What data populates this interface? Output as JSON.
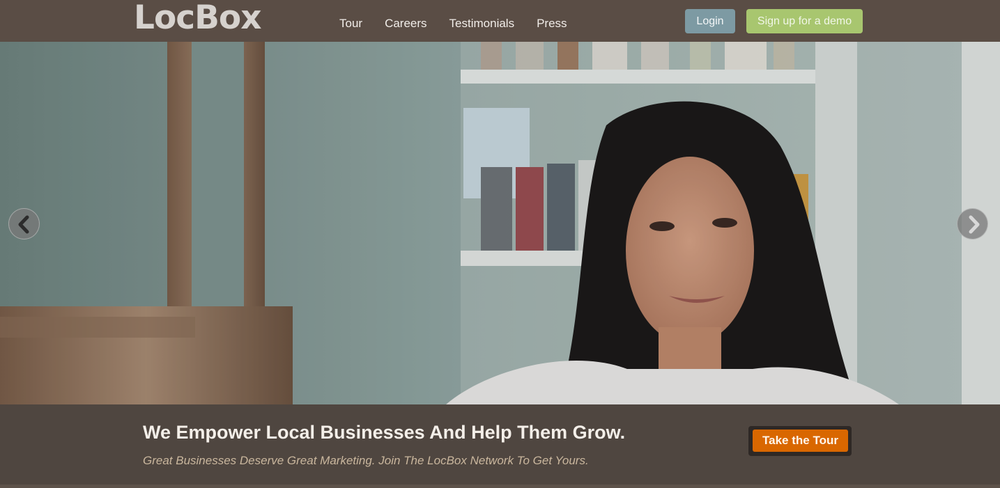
{
  "header": {
    "logo_text": "LocBox",
    "nav": [
      {
        "label": "Tour"
      },
      {
        "label": "Careers"
      },
      {
        "label": "Testimonials"
      },
      {
        "label": "Press"
      }
    ],
    "login_label": "Login",
    "demo_label": "Sign up for a demo"
  },
  "hero": {
    "headline": "We Empower Local Businesses And Help Them Grow.",
    "subline": "Great Businesses Deserve Great Marketing. Join The LocBox Network To Get Yours.",
    "cta_label": "Take the Tour",
    "prev_icon": "chevron-left-icon",
    "next_icon": "chevron-right-icon"
  },
  "colors": {
    "header_bg": "#5a4d45",
    "login_bg": "#7d9aa3",
    "demo_bg": "#a8c66f",
    "cta_bg": "#d96700",
    "band_bg": "#4f4640"
  }
}
